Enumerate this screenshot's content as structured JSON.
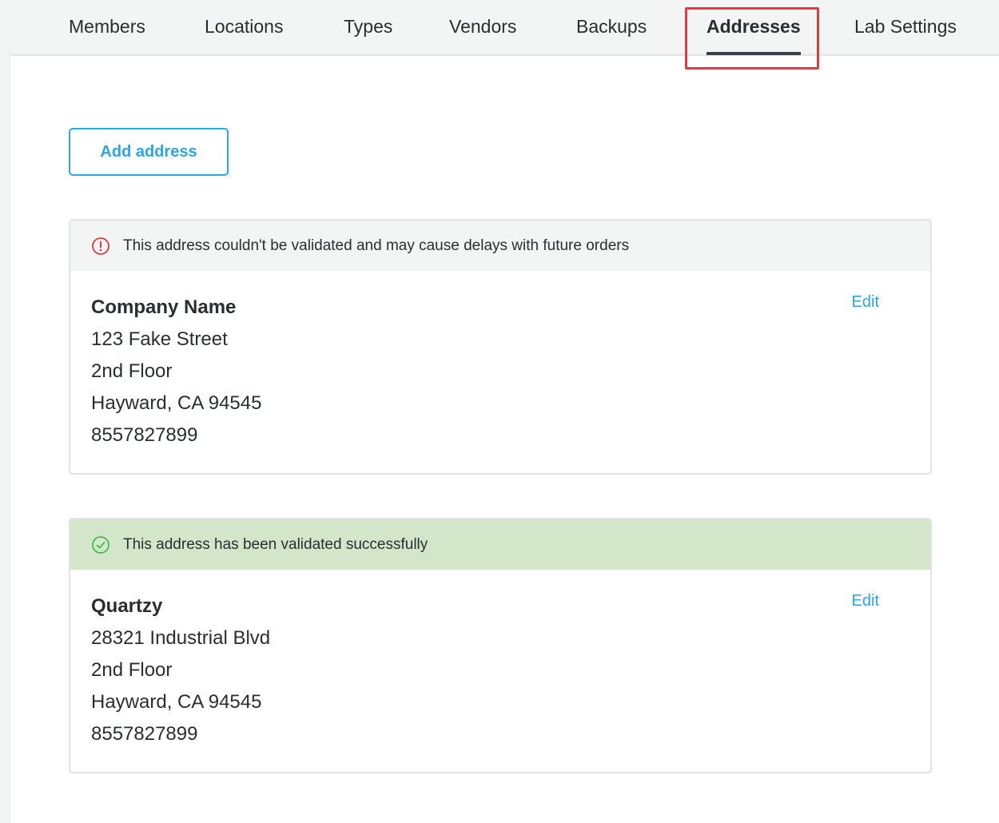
{
  "tabs": [
    {
      "label": "Members",
      "active": false
    },
    {
      "label": "Locations",
      "active": false
    },
    {
      "label": "Types",
      "active": false
    },
    {
      "label": "Vendors",
      "active": false
    },
    {
      "label": "Backups",
      "active": false
    },
    {
      "label": "Addresses",
      "active": true
    },
    {
      "label": "Lab Settings",
      "active": false
    }
  ],
  "actions": {
    "add_address_label": "Add address"
  },
  "colors": {
    "accent": "#2ca6de",
    "highlight_border": "#d63f47",
    "warning_icon": "#e0262b",
    "success_icon": "#2fb84a",
    "success_banner": "#d3e6ca",
    "warning_banner": "#f3f4f4"
  },
  "addresses": [
    {
      "status": "error",
      "status_icon": "exclamation-circle-icon",
      "status_message": "This address couldn't be validated and may cause delays with future orders",
      "name": "Company Name",
      "lines": [
        "123 Fake Street",
        "2nd Floor",
        "Hayward, CA 94545",
        "8557827899"
      ],
      "edit_label": "Edit"
    },
    {
      "status": "valid",
      "status_icon": "check-circle-icon",
      "status_message": "This address has been validated successfully",
      "name": "Quartzy",
      "lines": [
        "28321 Industrial Blvd",
        "2nd Floor",
        "Hayward, CA 94545",
        "8557827899"
      ],
      "edit_label": "Edit"
    }
  ]
}
